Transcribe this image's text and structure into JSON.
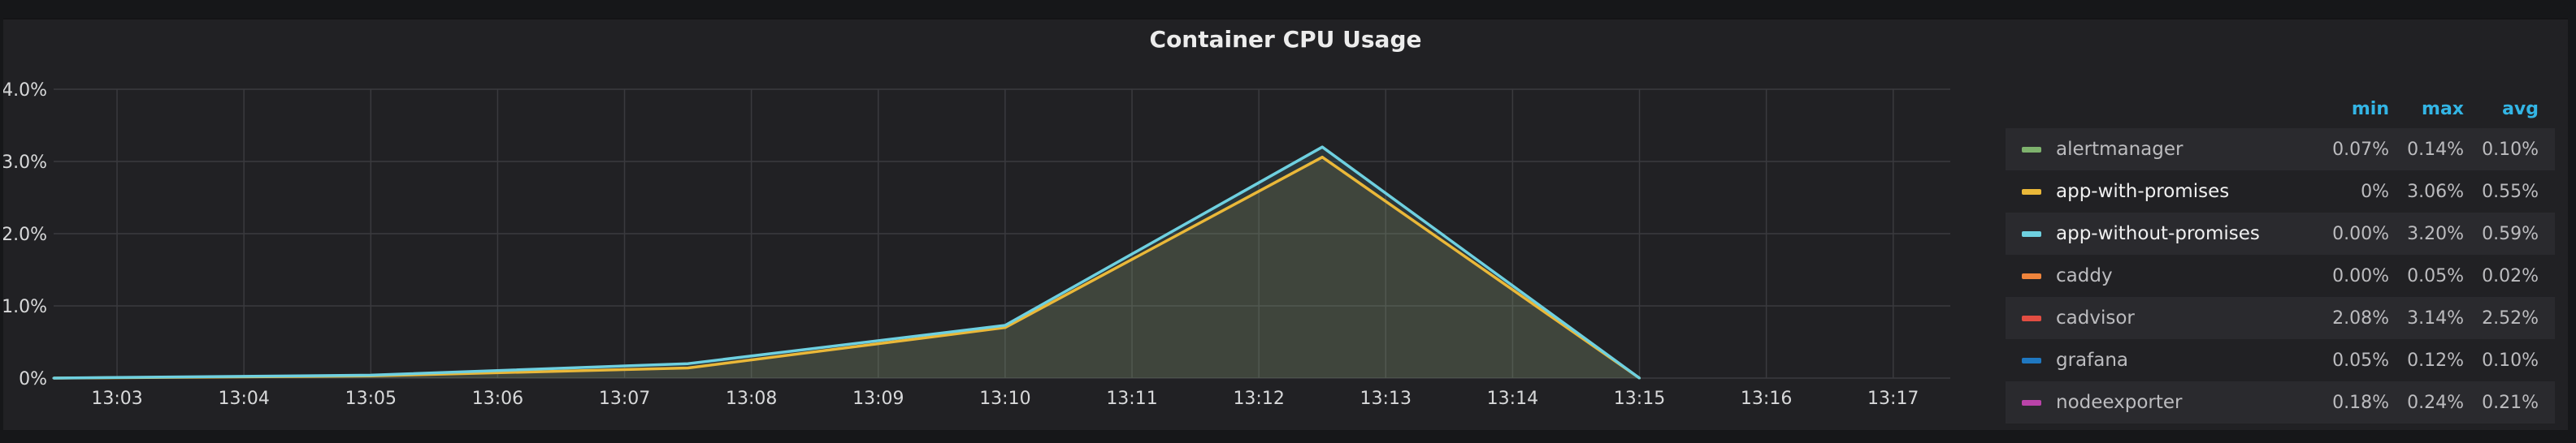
{
  "panel": {
    "title": "Container CPU Usage"
  },
  "chart_data": {
    "type": "line",
    "title": "Container CPU Usage",
    "xlabel": "",
    "ylabel": "",
    "x_ticks": [
      "13:03",
      "13:04",
      "13:05",
      "13:06",
      "13:07",
      "13:08",
      "13:09",
      "13:10",
      "13:11",
      "13:12",
      "13:13",
      "13:14",
      "13:15",
      "13:16",
      "13:17"
    ],
    "y_ticks": [
      "0%",
      "1.0%",
      "2.0%",
      "3.0%",
      "4.0%"
    ],
    "ylim": [
      0,
      4.0
    ],
    "y_unit": "%",
    "grid": true,
    "legend_position": "right",
    "series": [
      {
        "name": "app-with-promises",
        "color": "#eab839",
        "fill": true,
        "x": [
          "13:02:30",
          "13:05:00",
          "13:07:30",
          "13:10:00",
          "13:12:30",
          "13:15:00"
        ],
        "values": [
          0,
          0.03,
          0.14,
          0.7,
          3.06,
          0
        ]
      },
      {
        "name": "app-without-promises",
        "color": "#6ed0e0",
        "fill": true,
        "x": [
          "13:02:30",
          "13:05:00",
          "13:07:30",
          "13:10:00",
          "13:12:30",
          "13:15:00"
        ],
        "values": [
          0,
          0.04,
          0.2,
          0.73,
          3.2,
          0
        ]
      }
    ]
  },
  "legend": {
    "headers": {
      "min": "min",
      "max": "max",
      "avg": "avg"
    },
    "rows": [
      {
        "name": "alertmanager",
        "color": "#7eb26d",
        "min": "0.07%",
        "max": "0.14%",
        "avg": "0.10%",
        "highlight": false
      },
      {
        "name": "app-with-promises",
        "color": "#eab839",
        "min": "0%",
        "max": "3.06%",
        "avg": "0.55%",
        "highlight": true
      },
      {
        "name": "app-without-promises",
        "color": "#6ed0e0",
        "min": "0.00%",
        "max": "3.20%",
        "avg": "0.59%",
        "highlight": true
      },
      {
        "name": "caddy",
        "color": "#ef843c",
        "min": "0.00%",
        "max": "0.05%",
        "avg": "0.02%",
        "highlight": false
      },
      {
        "name": "cadvisor",
        "color": "#e24d42",
        "min": "2.08%",
        "max": "3.14%",
        "avg": "2.52%",
        "highlight": false
      },
      {
        "name": "grafana",
        "color": "#1f78c1",
        "min": "0.05%",
        "max": "0.12%",
        "avg": "0.10%",
        "highlight": false
      },
      {
        "name": "nodeexporter",
        "color": "#ba43a9",
        "min": "0.18%",
        "max": "0.24%",
        "avg": "0.21%",
        "highlight": false
      }
    ]
  }
}
